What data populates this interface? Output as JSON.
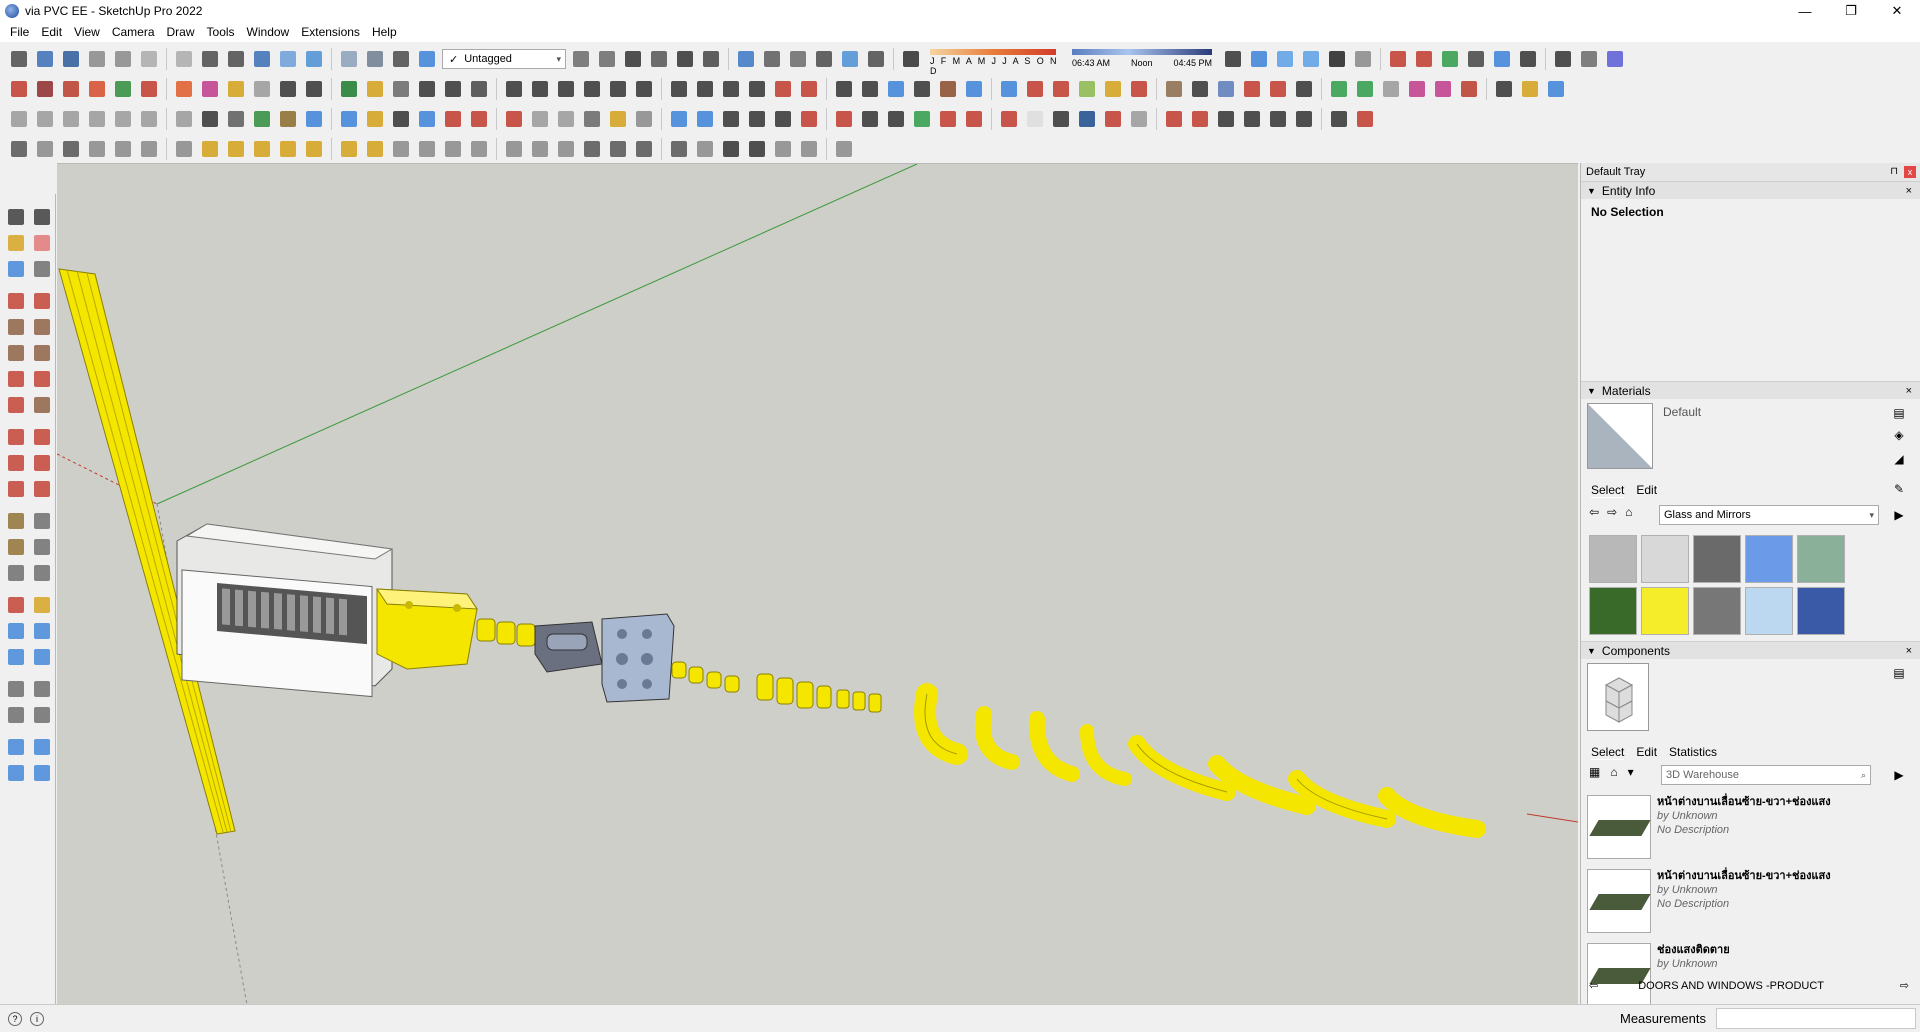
{
  "window": {
    "title": "via PVC EE - SketchUp Pro 2022",
    "minimize": "—",
    "maximize": "❐",
    "close": "✕"
  },
  "menu": [
    "File",
    "Edit",
    "View",
    "Camera",
    "Draw",
    "Tools",
    "Window",
    "Extensions",
    "Help"
  ],
  "toolbar": {
    "tag_selector": {
      "check": "✓",
      "value": "Untagged"
    },
    "shadow_months": "J F M A M J J A S O N D",
    "shadow_times": {
      "start": "06:43 AM",
      "mid": "Noon",
      "end": "04:45 PM"
    },
    "icon_colors": {
      "row1": [
        "#4b4b4b",
        "#3a6fb5",
        "#2d5a9a",
        "#888",
        "#888",
        "#aaa",
        "#aaa",
        "#4b4b4b",
        "#4b4b4b",
        "#3a6fb5",
        "#6a9fd8",
        "#4b8fd4",
        "#8aa0b8",
        "#6c7c8e",
        "#4a4a4a",
        "#3b82d8"
      ],
      "row1b": [
        "#6a6a6a",
        "#6a6a6a",
        "#333",
        "#555",
        "#333",
        "#444",
        "#3a77c4",
        "#5b5b5b",
        "#6a6a6a",
        "#4a4a4a",
        "#4b8fd4",
        "#4b4b4b",
        "#2d2d2d"
      ],
      "row1c": [
        "#333",
        "#3b82d8",
        "#5aa0e8",
        "#5aa0e8",
        "#222",
        "#888",
        "#c0392b",
        "#c0392b",
        "#2e9b48",
        "#444",
        "#3b82d8",
        "#333",
        "#333",
        "#6a6a6a",
        "#5b5bd6"
      ],
      "row2": [
        "#c0392b",
        "#8e2a2a",
        "#b8392a",
        "#d44a2a",
        "#2e8b3a",
        "#c0392b",
        "#e05a2a",
        "#c03a8a",
        "#d4a017",
        "#999",
        "#333",
        "#333",
        "#1a7a2a",
        "#d4a017",
        "#666",
        "#333",
        "#333",
        "#444",
        "#333",
        "#333",
        "#333",
        "#333",
        "#333",
        "#333",
        "#333",
        "#333",
        "#333",
        "#333",
        "#c0392b",
        "#c0392b",
        "#333",
        "#333",
        "#3b82d8",
        "#333",
        "#8a4a2a",
        "#3b82d8",
        "#3b82d8",
        "#c0392b",
        "#c0392b",
        "#8ab84a",
        "#d4a017",
        "#c0392b",
        "#8a6a4a",
        "#333",
        "#5a7ab8",
        "#c0392b",
        "#c0392b",
        "#333",
        "#2e9b48",
        "#2e9b48",
        "#999",
        "#c03a8a",
        "#c03a8a",
        "#b8392a",
        "#333",
        "#d4a017",
        "#3b82d8"
      ],
      "row3": [
        "#999",
        "#999",
        "#999",
        "#999",
        "#999",
        "#999",
        "#999",
        "#333",
        "#5a5a5a",
        "#2e8b3a",
        "#8a6a2a",
        "#3b82d8",
        "#3b82d8",
        "#d4a017",
        "#333",
        "#3b82d8",
        "#c0392b",
        "#c0392b",
        "#c0392b",
        "#999",
        "#999",
        "#666",
        "#d4a017",
        "#888",
        "#3b82d8",
        "#3b82d8",
        "#333",
        "#333",
        "#333",
        "#c0392b",
        "#c0392b",
        "#333",
        "#333",
        "#2e9b48",
        "#c0392b",
        "#c0392b",
        "#c0392b",
        "#ddd",
        "#333",
        "#1a4a8a",
        "#c0392b",
        "#999",
        "#c0392b",
        "#c0392b",
        "#333",
        "#333",
        "#333",
        "#333",
        "#333",
        "#c0392b"
      ],
      "row4": [
        "#555",
        "#888",
        "#555",
        "#888",
        "#888",
        "#888",
        "#888",
        "#d4a017",
        "#d4a017",
        "#d4a017",
        "#d4a017",
        "#d4a017",
        "#d4a017",
        "#d4a017",
        "#888",
        "#888",
        "#888",
        "#888",
        "#888",
        "#888",
        "#888",
        "#555",
        "#555",
        "#555",
        "#555",
        "#888",
        "#333",
        "#333",
        "#888",
        "#888",
        "#888"
      ]
    }
  },
  "left_toolbar": {
    "icon_colors": [
      [
        "#333",
        "#333"
      ],
      [
        "#d4a017",
        "#e07070"
      ],
      [
        "#3b82d8",
        "#666"
      ],
      [
        "#c0392b",
        "#c0392b"
      ],
      [
        "#8a5a3a",
        "#8a5a3a"
      ],
      [
        "#8a5a3a",
        "#8a5a3a"
      ],
      [
        "#c0392b",
        "#c0392b"
      ],
      [
        "#c0392b",
        "#8a5a3a"
      ],
      [
        "#c0392b",
        "#c0392b"
      ],
      [
        "#c0392b",
        "#c0392b"
      ],
      [
        "#c0392b",
        "#c0392b"
      ],
      [
        "#8a6a2a",
        "#666"
      ],
      [
        "#8a6a2a",
        "#666"
      ],
      [
        "#666",
        "#666"
      ],
      [
        "#c0392b",
        "#d4a017"
      ],
      [
        "#3b82d8",
        "#3b82d8"
      ],
      [
        "#3b82d8",
        "#3b82d8"
      ],
      [
        "#666",
        "#666"
      ],
      [
        "#666",
        "#666"
      ],
      [
        "#3b82d8",
        "#3b82d8"
      ],
      [
        "#3b82d8",
        "#3b82d8"
      ]
    ]
  },
  "tray": {
    "title": "Default Tray",
    "pin": "⊓",
    "close": "x",
    "entity_info": {
      "title": "Entity Info",
      "status": "No Selection"
    },
    "materials": {
      "title": "Materials",
      "current_name": "Default",
      "tabs": [
        "Select",
        "Edit"
      ],
      "library": "Glass and Mirrors",
      "swatch_colors": [
        "#b8b8b8",
        "#d8d8d8",
        "#6a6a6a",
        "#6a9ae8",
        "#8ab09a",
        "#3a6a2a",
        "#f5ec2a",
        "#777",
        "#bcd8f0",
        "#3a5aa8"
      ]
    },
    "components": {
      "title": "Components",
      "tabs": [
        "Select",
        "Edit",
        "Statistics"
      ],
      "search_placeholder": "3D Warehouse",
      "results": [
        {
          "name": "หน้าต่างบานเลื่อนซ้าย-ขวา+ช่องแสง",
          "by_prefix": "by",
          "author": "Unknown",
          "desc": "No Description"
        },
        {
          "name": "หน้าต่างบานเลื่อนซ้าย-ขวา+ช่องแสง",
          "by_prefix": "by",
          "author": "Unknown",
          "desc": "No Description"
        },
        {
          "name": "ช่องแสงติดตาย",
          "by_prefix": "by",
          "author": "Unknown",
          "desc": ""
        }
      ],
      "footer": "DOORS AND WINDOWS -PRODUCT"
    }
  },
  "status": {
    "measurements_label": "Measurements",
    "measurements_value": ""
  },
  "colors": {
    "sky": "#cfcfca",
    "pvc_yellow": "#f5e600",
    "axis_green": "#3c9a3c",
    "axis_red": "#c0392b"
  }
}
